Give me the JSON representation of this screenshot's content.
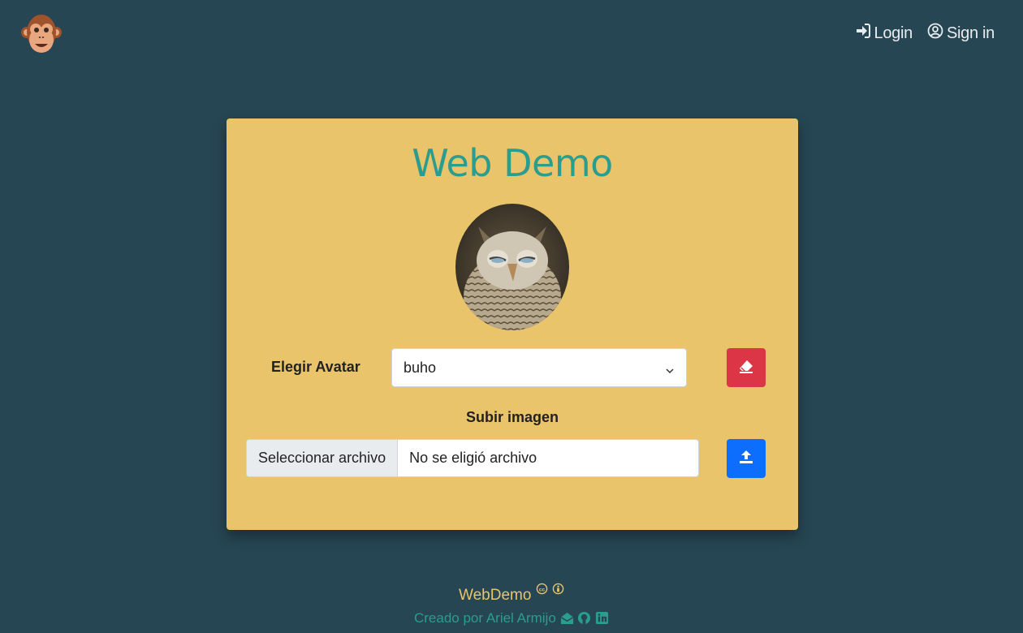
{
  "header": {
    "login_label": "Login",
    "signin_label": "Sign in"
  },
  "card": {
    "title": "Web Demo",
    "avatar_label": "Elegir Avatar",
    "avatar_selected": "buho",
    "upload_label": "Subir imagen",
    "file_button_label": "Seleccionar archivo",
    "file_status": "No se eligió archivo"
  },
  "footer": {
    "brand": "WebDemo",
    "credit": "Creado por Ariel Armijo"
  },
  "colors": {
    "background": "#264653",
    "card": "#e9c46a",
    "accent": "#2a9d8f",
    "danger": "#dc3545",
    "primary": "#0d6efd"
  }
}
